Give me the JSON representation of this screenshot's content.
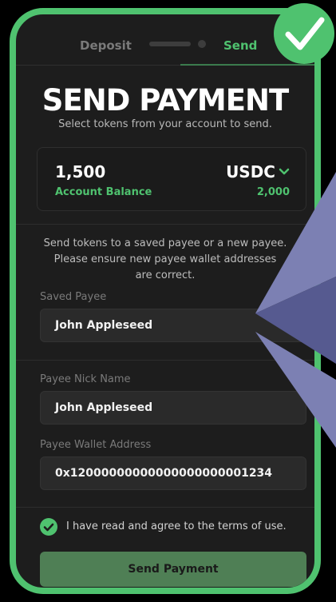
{
  "tabs": {
    "deposit": "Deposit",
    "send": "Send",
    "active": "Send"
  },
  "header": {
    "title": "SEND PAYMENT",
    "subtitle": "Select tokens from your account to send."
  },
  "balance": {
    "amount": "1,500",
    "amount_label": "Account Balance",
    "token": "USDC",
    "token_value": "2,000"
  },
  "info_text": [
    "Send tokens to a saved payee or a new payee.",
    "Please ensure new payee wallet addresses",
    "are correct."
  ],
  "form": {
    "saved_payee_label": "Saved Payee",
    "saved_payee_value": "John Appleseed",
    "nickname_label": "Payee Nick Name",
    "nickname_value": "John Appleseed",
    "wallet_label": "Payee Wallet Address",
    "wallet_value": "0x12000000000000000000001234"
  },
  "terms": {
    "label": "I have read and agree to the terms of use.",
    "checked": true
  },
  "submit_label": "Send Payment",
  "colors": {
    "accent": "#4fc26f",
    "background": "#1d1d1d",
    "button": "#4f7f55"
  },
  "icons": {
    "badge": "checkmark-badge-icon",
    "token_dropdown": "chevron-down-icon",
    "terms": "check-circle-icon",
    "overlay": "ethereum-logo-icon"
  }
}
